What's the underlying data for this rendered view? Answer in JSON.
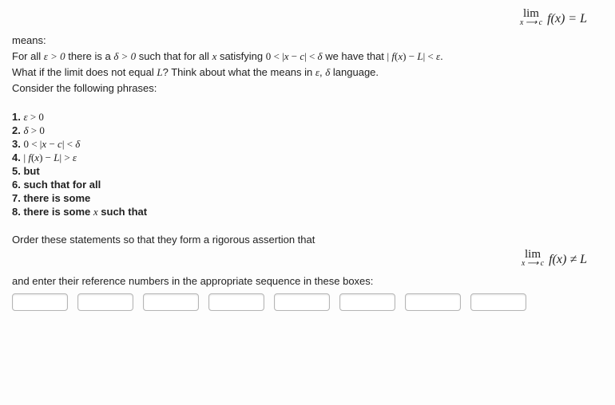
{
  "top_equation": {
    "lim_label": "lim",
    "lim_sub": "x ⟶ c",
    "expr": "f(x) = L"
  },
  "intro": {
    "means_label": "means:",
    "definition_pre": "For all ",
    "eps_gt_0": "ε > 0",
    "definition_mid1": " there is a ",
    "delta_gt_0": "δ > 0",
    "definition_mid2": " such that for all ",
    "x_var": "x",
    "definition_mid3": " satisfying ",
    "ineq1": "0 < |x − c| < δ",
    "definition_mid4": " we have that ",
    "ineq2": "| f(x) − L| < ε",
    "period": ".",
    "question": "What if the limit does not equal ",
    "L": "L",
    "question2": "? Think about what the means in ",
    "eps": "ε",
    "comma": ", ",
    "delta": "δ",
    "question3": " language.",
    "consider": "Consider the following phrases:"
  },
  "phrases": {
    "p1_num": "1. ",
    "p1": "ε > 0",
    "p2_num": "2. ",
    "p2": "δ > 0",
    "p3_num": "3. ",
    "p3": "0 < |x − c| < δ",
    "p4_num": "4. ",
    "p4": "| f(x) − L| > ε",
    "p5": "5. but",
    "p6": "6. such that for all",
    "p7": "7. there is some",
    "p8_pre": "8. there is some ",
    "p8_x": "x",
    "p8_post": " such that"
  },
  "order_prompt": "Order these statements so that they form a rigorous assertion that",
  "bottom_equation": {
    "lim_label": "lim",
    "lim_sub": "x ⟶ c",
    "expr": "f(x) ≠ L"
  },
  "enter_prompt": "and enter their reference numbers in the appropriate sequence in these boxes:",
  "inputs": {
    "count": 8
  }
}
